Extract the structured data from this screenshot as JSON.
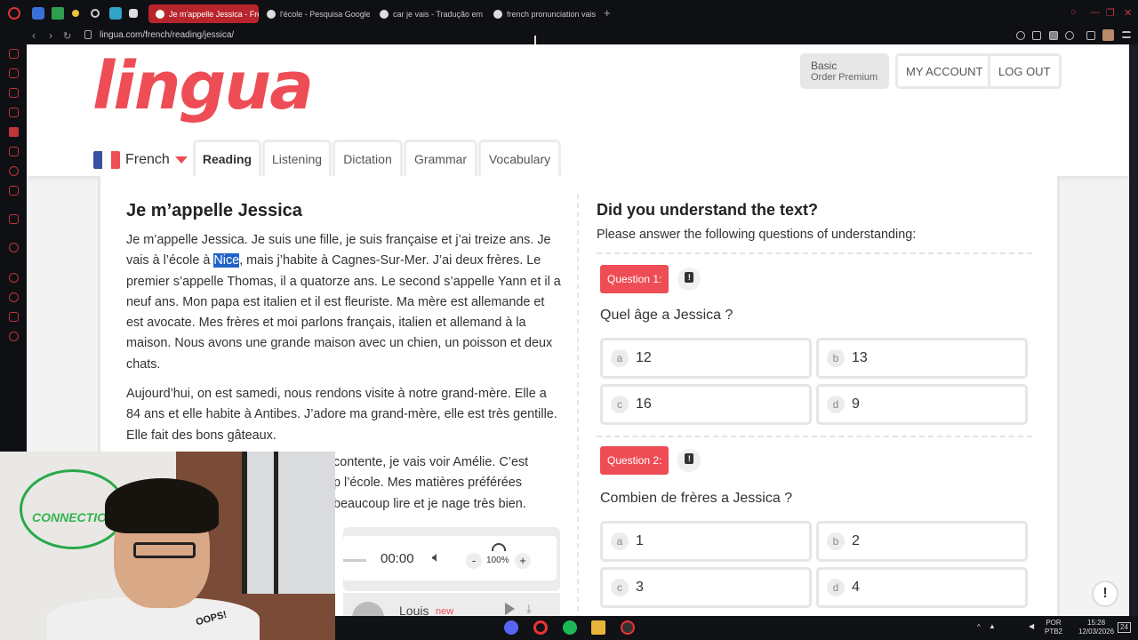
{
  "browser": {
    "tabs": [
      {
        "label": "Je m'appelle Jessica - Fre",
        "active": true
      },
      {
        "label": "l'école - Pesquisa Google",
        "active": false
      },
      {
        "label": "car je vais - Tradução em",
        "active": false
      },
      {
        "label": "french pronunciation vais",
        "active": false
      }
    ],
    "url": "lingua.com/french/reading/jessica/"
  },
  "header": {
    "logo": "lingua",
    "plan": {
      "title": "Basic",
      "subtitle": "Order Premium"
    },
    "my_account": "MY ACCOUNT",
    "logout": "LOG OUT",
    "language": "French",
    "nav_tabs": [
      "Reading",
      "Listening",
      "Dictation",
      "Grammar",
      "Vocabulary"
    ]
  },
  "text": {
    "title": "Je m’appelle Jessica",
    "p1_before": "Je m’appelle Jessica. Je suis une fille, je suis française et j’ai treize ans. Je vais à l’école à ",
    "p1_selected": "Nice",
    "p1_after": ", mais j’habite à Cagnes-Sur-Mer. J’ai deux frères. Le premier s’appelle Thomas, il a quatorze ans. Le second s’appelle Yann et il a neuf ans. Mon papa est italien et il est fleuriste. Ma mère est allemande et est avocate. Mes frères et moi parlons français, italien et allemand à la maison. Nous avons une grande maison avec un chien, un poisson et deux chats.",
    "p2": "Aujourd’hui, on est samedi, nous rendons visite à notre grand-mère. Elle a 84 ans et elle habite à Antibes. J’adore ma grand-mère, elle est très gentille. Elle fait des bons gâteaux.",
    "p3_line1": "contente, je vais voir Amélie. C’est",
    "p3_line2": "p l’école. Mes matières préférées",
    "p3_line3": "beaucoup lire et je nage très bien."
  },
  "player": {
    "time": "00:00",
    "speed": "100%",
    "minus": "-",
    "plus": "+",
    "voice_name": "Louis",
    "voice_badge": "new"
  },
  "quiz": {
    "title": "Did you understand the text?",
    "subtitle": "Please answer the following questions of understanding:",
    "questions": [
      {
        "badge": "Question 1:",
        "text": "Quel âge a Jessica ?",
        "options": [
          {
            "letter": "a",
            "value": "12"
          },
          {
            "letter": "b",
            "value": "13"
          },
          {
            "letter": "c",
            "value": "16"
          },
          {
            "letter": "d",
            "value": "9"
          }
        ]
      },
      {
        "badge": "Question 2:",
        "text": "Combien de frères a Jessica ?",
        "options": [
          {
            "letter": "a",
            "value": "1"
          },
          {
            "letter": "b",
            "value": "2"
          },
          {
            "letter": "c",
            "value": "3"
          },
          {
            "letter": "d",
            "value": "4"
          }
        ]
      }
    ]
  },
  "webcam": {
    "logo_text": "CONNECTION",
    "shirt_text": "OOPS!"
  },
  "taskbar": {
    "lang_line1": "POR",
    "lang_line2": "PTB2",
    "time": "15:28",
    "date": "12/03/2026",
    "notif": "24"
  },
  "colors": {
    "brand": "#ee4d55",
    "selection": "#1e62c8"
  }
}
